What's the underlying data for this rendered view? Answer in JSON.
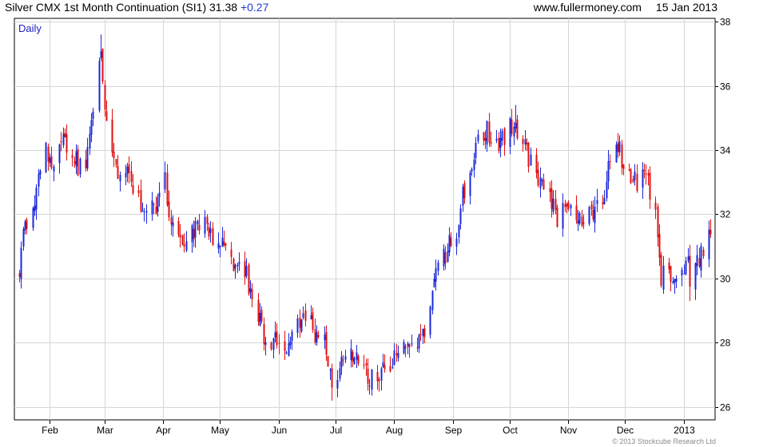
{
  "header": {
    "title": "Silver CMX 1st Month Continuation (SI1)",
    "last": "31.38",
    "change": "+0.27",
    "site": "www.fullermoney.com",
    "date": "15 Jan 2013"
  },
  "footer": {
    "copyright": "© 2013 Stockcube Research Ltd"
  },
  "colors": {
    "up": "#1b28d8",
    "down": "#e01010",
    "grid": "#d6d6d6",
    "label_period": "#2020c0"
  },
  "chart_data": {
    "type": "candlestick",
    "period_label": "Daily",
    "ylim": [
      25.6,
      38.1
    ],
    "yticks": [
      26,
      28,
      30,
      32,
      34,
      36,
      38
    ],
    "x_start": "2012-01-16",
    "x_end": "2013-01-15",
    "month_labels": [
      {
        "label": "Feb",
        "date": "2012-02-01"
      },
      {
        "label": "Mar",
        "date": "2012-03-01"
      },
      {
        "label": "Apr",
        "date": "2012-04-01"
      },
      {
        "label": "May",
        "date": "2012-05-01"
      },
      {
        "label": "Jun",
        "date": "2012-06-01"
      },
      {
        "label": "Jul",
        "date": "2012-07-01"
      },
      {
        "label": "Aug",
        "date": "2012-08-01"
      },
      {
        "label": "Sep",
        "date": "2012-09-01"
      },
      {
        "label": "Oct",
        "date": "2012-10-01"
      },
      {
        "label": "Nov",
        "date": "2012-11-01"
      },
      {
        "label": "Dec",
        "date": "2012-12-01"
      },
      {
        "label": "2013",
        "date": "2013-01-01"
      }
    ],
    "close_path": [
      [
        "2012-01-16",
        30.4
      ],
      [
        "2012-01-19",
        31.7
      ],
      [
        "2012-01-23",
        32.2
      ],
      [
        "2012-01-26",
        33.3
      ],
      [
        "2012-01-30",
        33.9
      ],
      [
        "2012-02-03",
        33.7
      ],
      [
        "2012-02-08",
        34.2
      ],
      [
        "2012-02-13",
        33.9
      ],
      [
        "2012-02-17",
        33.4
      ],
      [
        "2012-02-21",
        33.8
      ],
      [
        "2012-02-24",
        35.2
      ],
      [
        "2012-02-28",
        37.0
      ],
      [
        "2012-03-01",
        35.2
      ],
      [
        "2012-03-05",
        34.1
      ],
      [
        "2012-03-08",
        33.3
      ],
      [
        "2012-03-12",
        33.6
      ],
      [
        "2012-03-15",
        32.7
      ],
      [
        "2012-03-20",
        32.3
      ],
      [
        "2012-03-26",
        32.2
      ],
      [
        "2012-03-29",
        32.4
      ],
      [
        "2012-04-02",
        33.0
      ],
      [
        "2012-04-05",
        31.5
      ],
      [
        "2012-04-11",
        31.3
      ],
      [
        "2012-04-17",
        31.5
      ],
      [
        "2012-04-23",
        31.7
      ],
      [
        "2012-04-27",
        31.2
      ],
      [
        "2012-05-02",
        31.0
      ],
      [
        "2012-05-07",
        30.4
      ],
      [
        "2012-05-11",
        30.8
      ],
      [
        "2012-05-15",
        30.1
      ],
      [
        "2012-05-18",
        29.0
      ],
      [
        "2012-05-22",
        28.6
      ],
      [
        "2012-05-25",
        27.9
      ],
      [
        "2012-05-30",
        28.1
      ],
      [
        "2012-06-04",
        27.8
      ],
      [
        "2012-06-08",
        28.1
      ],
      [
        "2012-06-12",
        28.6
      ],
      [
        "2012-06-15",
        29.0
      ],
      [
        "2012-06-20",
        28.3
      ],
      [
        "2012-06-25",
        28.0
      ],
      [
        "2012-06-28",
        27.1
      ],
      [
        "2012-07-02",
        26.5
      ],
      [
        "2012-07-05",
        27.7
      ],
      [
        "2012-07-09",
        27.6
      ],
      [
        "2012-07-13",
        27.3
      ],
      [
        "2012-07-18",
        26.9
      ],
      [
        "2012-07-23",
        27.0
      ],
      [
        "2012-07-27",
        27.3
      ],
      [
        "2012-08-01",
        27.5
      ],
      [
        "2012-08-06",
        27.8
      ],
      [
        "2012-08-10",
        28.0
      ],
      [
        "2012-08-14",
        27.9
      ],
      [
        "2012-08-17",
        28.2
      ],
      [
        "2012-08-21",
        29.4
      ],
      [
        "2012-08-24",
        30.5
      ],
      [
        "2012-08-29",
        30.9
      ],
      [
        "2012-09-03",
        31.5
      ],
      [
        "2012-09-06",
        32.6
      ],
      [
        "2012-09-10",
        33.5
      ],
      [
        "2012-09-14",
        34.3
      ],
      [
        "2012-09-19",
        34.6
      ],
      [
        "2012-09-24",
        34.2
      ],
      [
        "2012-09-28",
        34.5
      ],
      [
        "2012-10-03",
        34.8
      ],
      [
        "2012-10-08",
        34.3
      ],
      [
        "2012-10-12",
        33.6
      ],
      [
        "2012-10-17",
        32.8
      ],
      [
        "2012-10-22",
        32.4
      ],
      [
        "2012-10-26",
        31.9
      ],
      [
        "2012-10-31",
        32.2
      ],
      [
        "2012-11-05",
        31.6
      ],
      [
        "2012-11-09",
        31.8
      ],
      [
        "2012-11-14",
        32.1
      ],
      [
        "2012-11-19",
        32.6
      ],
      [
        "2012-11-23",
        33.6
      ],
      [
        "2012-11-27",
        34.1
      ],
      [
        "2012-11-30",
        33.6
      ],
      [
        "2012-12-04",
        33.1
      ],
      [
        "2012-12-07",
        33.0
      ],
      [
        "2012-12-11",
        33.4
      ],
      [
        "2012-12-14",
        32.7
      ],
      [
        "2012-12-17",
        32.0
      ],
      [
        "2012-12-20",
        30.1
      ],
      [
        "2012-12-24",
        30.0
      ],
      [
        "2012-12-28",
        30.1
      ],
      [
        "2013-01-02",
        30.6
      ],
      [
        "2013-01-04",
        30.1
      ],
      [
        "2013-01-08",
        30.4
      ],
      [
        "2013-01-11",
        30.9
      ],
      [
        "2013-01-15",
        31.38
      ]
    ],
    "extremes": [
      {
        "date": "2012-02-28",
        "high": 37.6
      },
      {
        "date": "2012-06-29",
        "low": 26.2
      },
      {
        "date": "2012-10-04",
        "high": 35.4
      },
      {
        "date": "2013-01-04",
        "low": 29.3
      }
    ]
  }
}
